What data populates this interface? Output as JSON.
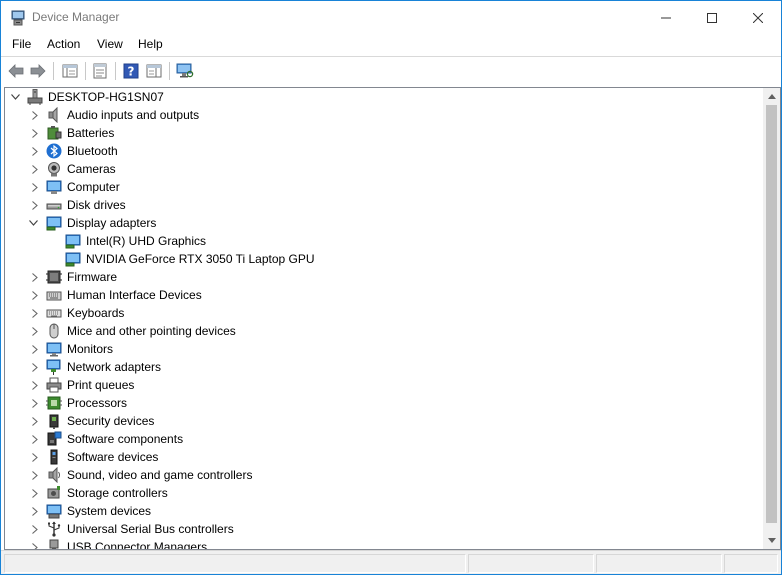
{
  "window": {
    "title": "Device Manager",
    "minimize": "—",
    "maximize": "☐",
    "close": "✕"
  },
  "menu": [
    "File",
    "Action",
    "View",
    "Help"
  ],
  "toolbar": [
    "back-icon",
    "forward-icon",
    "show-hide-console-tree-icon",
    "properties-icon",
    "help-icon",
    "action-pane-icon",
    "scan-hardware-icon"
  ],
  "tree": {
    "root": "DESKTOP-HG1SN07",
    "categories": [
      {
        "label": "Audio inputs and outputs",
        "icon": "speaker-icon",
        "expanded": false
      },
      {
        "label": "Batteries",
        "icon": "battery-icon",
        "expanded": false
      },
      {
        "label": "Bluetooth",
        "icon": "bluetooth-icon",
        "expanded": false
      },
      {
        "label": "Cameras",
        "icon": "camera-icon",
        "expanded": false
      },
      {
        "label": "Computer",
        "icon": "computer-icon",
        "expanded": false
      },
      {
        "label": "Disk drives",
        "icon": "disk-drive-icon",
        "expanded": false
      },
      {
        "label": "Display adapters",
        "icon": "display-adapter-icon",
        "expanded": true,
        "children": [
          "Intel(R) UHD Graphics",
          "NVIDIA GeForce RTX 3050 Ti Laptop GPU"
        ]
      },
      {
        "label": "Firmware",
        "icon": "firmware-icon",
        "expanded": false
      },
      {
        "label": "Human Interface Devices",
        "icon": "hid-icon",
        "expanded": false
      },
      {
        "label": "Keyboards",
        "icon": "keyboard-icon",
        "expanded": false
      },
      {
        "label": "Mice and other pointing devices",
        "icon": "mouse-icon",
        "expanded": false
      },
      {
        "label": "Monitors",
        "icon": "monitor-icon",
        "expanded": false
      },
      {
        "label": "Network adapters",
        "icon": "network-adapter-icon",
        "expanded": false
      },
      {
        "label": "Print queues",
        "icon": "printer-icon",
        "expanded": false
      },
      {
        "label": "Processors",
        "icon": "processor-icon",
        "expanded": false
      },
      {
        "label": "Security devices",
        "icon": "security-device-icon",
        "expanded": false
      },
      {
        "label": "Software components",
        "icon": "software-component-icon",
        "expanded": false
      },
      {
        "label": "Software devices",
        "icon": "software-device-icon",
        "expanded": false
      },
      {
        "label": "Sound, video and game controllers",
        "icon": "sound-controller-icon",
        "expanded": false
      },
      {
        "label": "Storage controllers",
        "icon": "storage-controller-icon",
        "expanded": false
      },
      {
        "label": "System devices",
        "icon": "system-device-icon",
        "expanded": false
      },
      {
        "label": "Universal Serial Bus controllers",
        "icon": "usb-controller-icon",
        "expanded": false
      },
      {
        "label": "USB Connector Managers",
        "icon": "usb-connector-icon",
        "expanded": false
      }
    ]
  },
  "colors": {
    "window_border": "#1883d7",
    "icon_blue": "#2b7bd3",
    "selection_none": "#ffffff"
  }
}
